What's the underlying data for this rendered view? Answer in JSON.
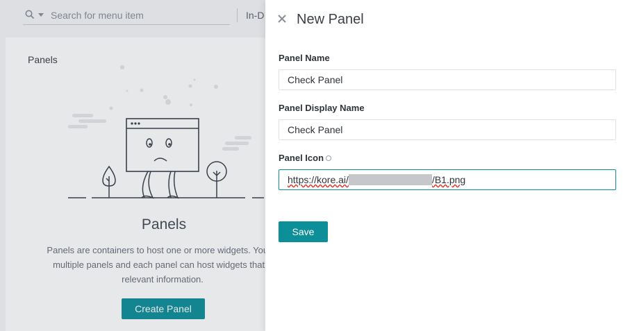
{
  "topbar": {
    "search_placeholder": "Search for menu item",
    "tab_label": "In-D"
  },
  "background": {
    "card_title": "Panels",
    "big_title": "Panels",
    "description_line1": "Panels are containers to host one or more widgets. You m",
    "description_line2": "multiple panels and each panel can host widgets that p",
    "description_line3": "relevant information.",
    "create_button": "Create Panel"
  },
  "panel": {
    "title": "New Panel",
    "name_label": "Panel Name",
    "name_value": "Check Panel",
    "display_label": "Panel Display Name",
    "display_value": "Check Panel",
    "icon_label": "Panel Icon",
    "icon_value_prefix": "https://kore.ai/",
    "icon_value_suffix": "/B1.png",
    "save_button": "Save"
  },
  "colors": {
    "accent": "#0d8f99",
    "overlay": "#3c4150"
  },
  "icons": [
    "search-icon",
    "chevron-down-icon",
    "close-icon",
    "info-icon"
  ]
}
